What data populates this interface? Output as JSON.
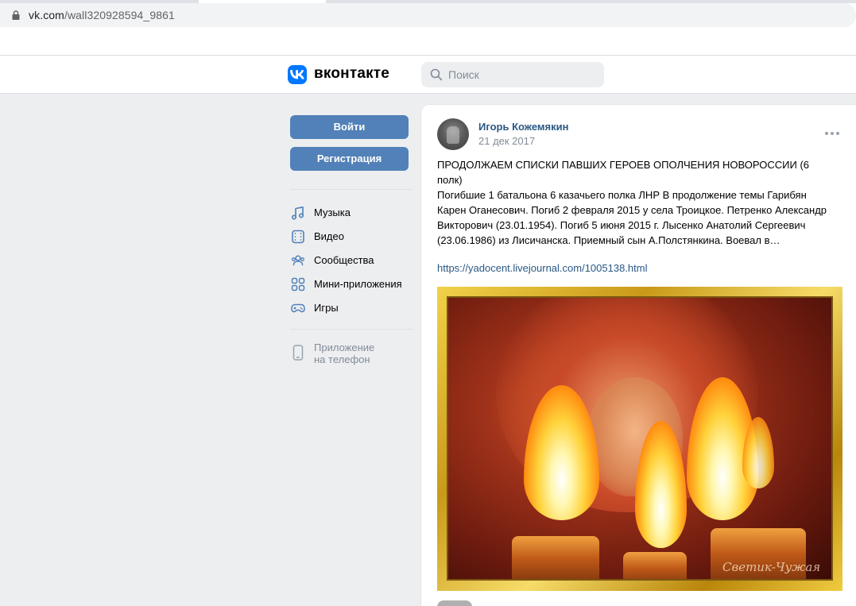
{
  "browser": {
    "url_host": "vk.com",
    "url_path": "/wall320928594_9861"
  },
  "header": {
    "brand": "вконтакте",
    "search_placeholder": "Поиск"
  },
  "sidebar": {
    "login_label": "Войти",
    "register_label": "Регистрация",
    "items": [
      {
        "label": "Музыка",
        "icon": "music-icon"
      },
      {
        "label": "Видео",
        "icon": "video-icon"
      },
      {
        "label": "Сообщества",
        "icon": "communities-icon"
      },
      {
        "label": "Мини-приложения",
        "icon": "mini-apps-icon"
      },
      {
        "label": "Игры",
        "icon": "gamepad-icon"
      }
    ],
    "phone_app_line1": "Приложение",
    "phone_app_line2": "на телефон"
  },
  "post": {
    "author": "Игорь Кожемякин",
    "date": "21 дек 2017",
    "title": "ПРОДОЛЖАЕМ СПИСКИ ПАВШИХ ГЕРОЕВ ОПОЛЧЕНИЯ НОВОРОССИИ (6 полк)",
    "body": "Погибшие 1 батальона 6 казачьего полка ЛНР В продолжение темы Гарибян Карен Оганесович. Погиб 2 февраля 2015 у села Троицкое. Петренко Александр Викторович (23.01.1954). Погиб 5 июня 2015 г. Лысенко Анатолий Сергеевич (23.06.1986) из Лисичанска. Приемный сын А.Полстянкина. Воевал в…",
    "link": "https://yadocent.livejournal.com/1005138.html",
    "image_signature": "Светик-Чужая"
  },
  "colors": {
    "vk_blue": "#0077ff",
    "button": "#5181b8",
    "link": "#2a5885",
    "muted": "#818c99",
    "page_bg": "#edeef0"
  }
}
